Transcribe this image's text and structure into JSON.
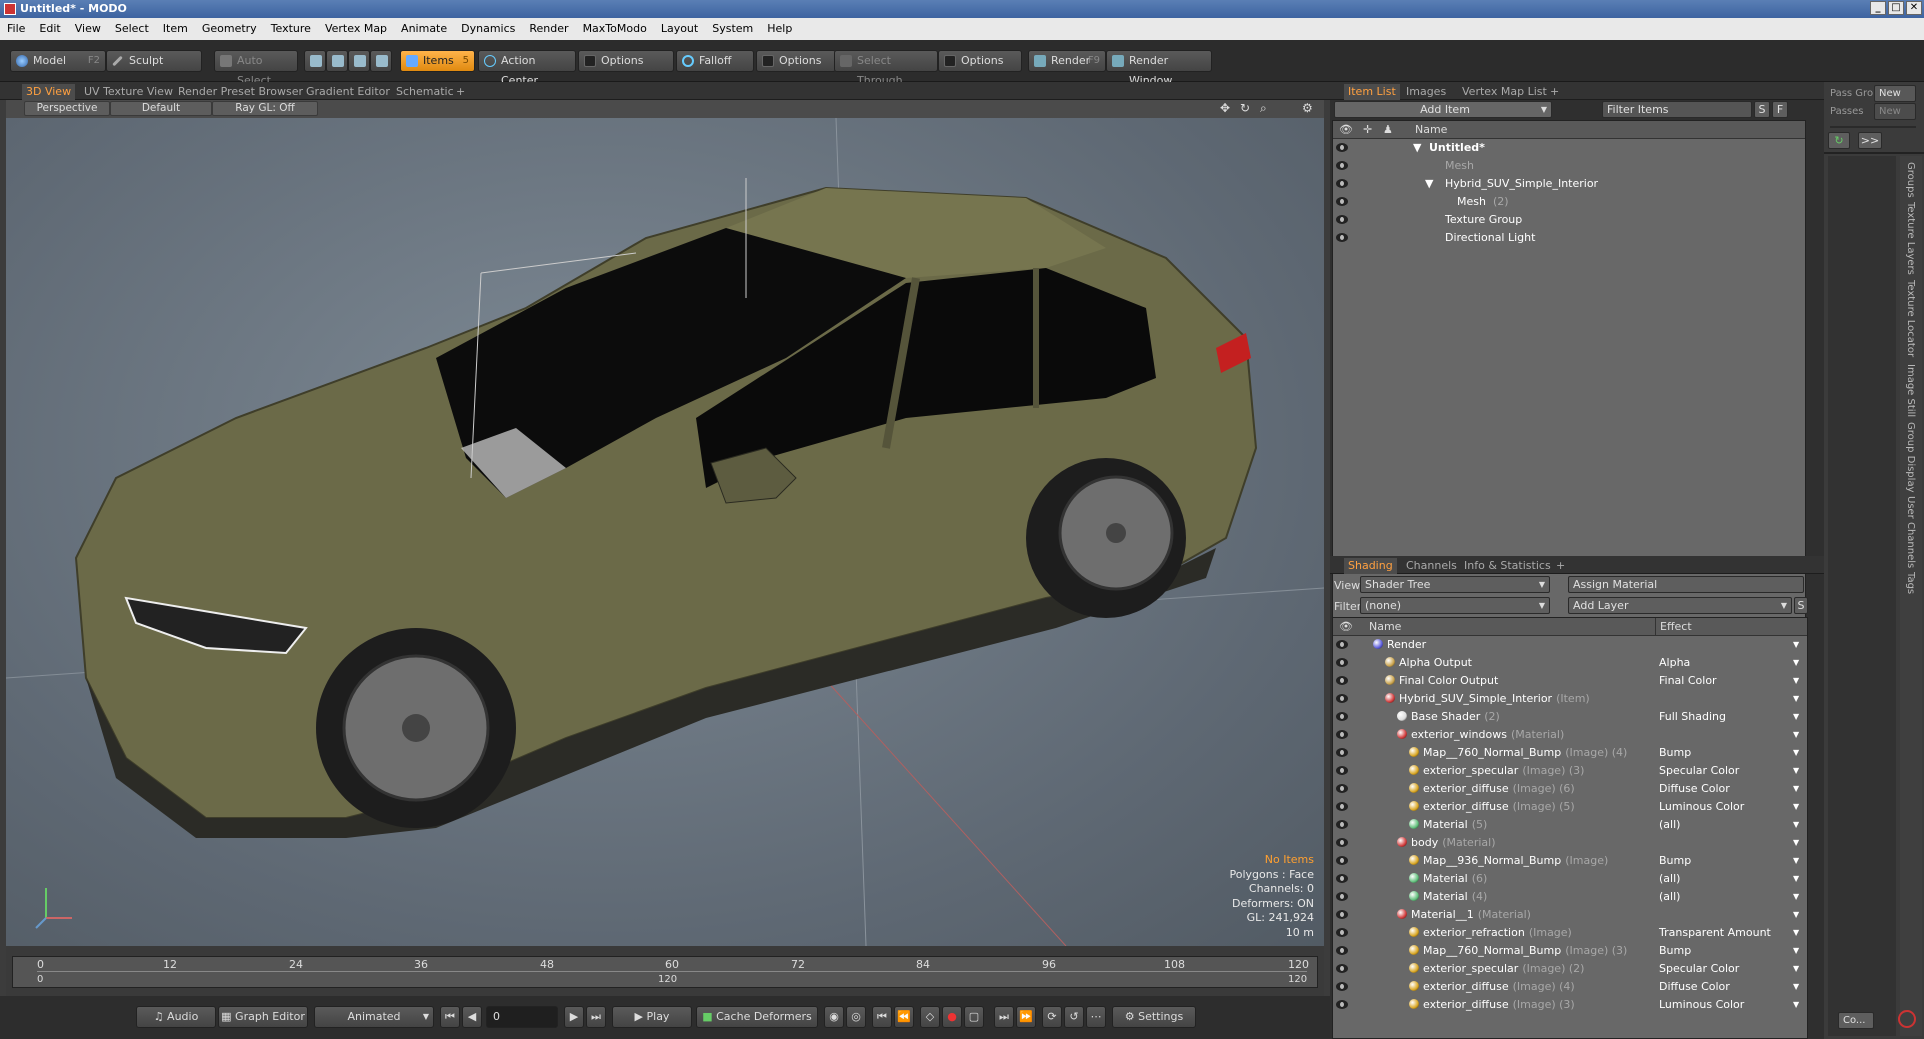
{
  "window": {
    "title": "Untitled* - MODO"
  },
  "menu": [
    "File",
    "Edit",
    "View",
    "Select",
    "Item",
    "Geometry",
    "Texture",
    "Vertex Map",
    "Animate",
    "Dynamics",
    "Render",
    "MaxToModo",
    "Layout",
    "System",
    "Help"
  ],
  "toolbar": {
    "model": "Model",
    "model_key": "F2",
    "sculpt": "Sculpt",
    "auto_select": "Auto Select",
    "items": "Items",
    "items_key": "5",
    "action_center": "Action Center",
    "options1": "Options",
    "falloff": "Falloff",
    "options2": "Options",
    "select_through": "Select Through",
    "options3": "Options",
    "render": "Render",
    "render_key": "F9",
    "render_window": "Render Window"
  },
  "viewport": {
    "tabs": [
      "3D View",
      "UV Texture View",
      "Render Preset Browser",
      "Gradient Editor",
      "Schematic",
      "+"
    ],
    "perspective": "Perspective",
    "default": "Default",
    "raygl": "Ray GL: Off",
    "stats": {
      "items": "No Items",
      "polygons": "Polygons : Face",
      "channels": "Channels: 0",
      "deformers": "Deformers: ON",
      "gl": "GL: 241,924",
      "scale": "10 m"
    }
  },
  "timeline": {
    "ticks": [
      "0",
      "12",
      "24",
      "36",
      "48",
      "60",
      "72",
      "84",
      "96",
      "108",
      "120"
    ],
    "start": "0",
    "mid": "120",
    "end": "120"
  },
  "transport": {
    "audio": "Audio",
    "graph_editor": "Graph Editor",
    "animated": "Animated",
    "frame": "0",
    "play": "Play",
    "cache_deformers": "Cache Deformers",
    "settings": "Settings"
  },
  "item_list": {
    "tabs": [
      "Item List",
      "Images",
      "Vertex Map List",
      "+"
    ],
    "add_item": "Add Item",
    "filter": "Filter Items",
    "s": "S",
    "f": "F",
    "col_name": "Name",
    "rows": [
      {
        "name": "Untitled*",
        "tag": ""
      },
      {
        "name": "Mesh",
        "tag": ""
      },
      {
        "name": "Hybrid_SUV_Simple_Interior",
        "tag": ""
      },
      {
        "name": "Mesh",
        "tag": "(2)"
      },
      {
        "name": "Texture Group",
        "tag": ""
      },
      {
        "name": "Directional Light",
        "tag": ""
      }
    ]
  },
  "shading": {
    "tabs": [
      "Shading",
      "Channels",
      "Info & Statistics",
      "+"
    ],
    "view_label": "View",
    "view": "Shader Tree",
    "assign": "Assign Material",
    "f": "F",
    "filter_label": "Filter",
    "filter": "(none)",
    "add_layer": "Add Layer",
    "s": "S",
    "col_name": "Name",
    "col_effect": "Effect",
    "rows": [
      {
        "name": "Render",
        "tag": "",
        "effect": "",
        "indent": 0,
        "color": "#5b5bdc"
      },
      {
        "name": "Alpha Output",
        "tag": "",
        "effect": "Alpha",
        "indent": 1,
        "color": "#c9a24a"
      },
      {
        "name": "Final Color Output",
        "tag": "",
        "effect": "Final Color",
        "indent": 1,
        "color": "#c9a24a"
      },
      {
        "name": "Hybrid_SUV_Simple_Interior",
        "tag": "(Item)",
        "effect": "",
        "indent": 1,
        "color": "#d23a3a"
      },
      {
        "name": "Base Shader",
        "tag": "(2)",
        "effect": "Full Shading",
        "indent": 2,
        "color": "#dddddd"
      },
      {
        "name": "exterior_windows",
        "tag": "(Material)",
        "effect": "",
        "indent": 2,
        "color": "#d23a3a"
      },
      {
        "name": "Map__760_Normal_Bump",
        "tag": "(Image) (4)",
        "effect": "Bump",
        "indent": 3,
        "color": "#d9a520"
      },
      {
        "name": "exterior_specular",
        "tag": "(Image) (3)",
        "effect": "Specular Color",
        "indent": 3,
        "color": "#d9a520"
      },
      {
        "name": "exterior_diffuse",
        "tag": "(Image) (6)",
        "effect": "Diffuse Color",
        "indent": 3,
        "color": "#d9a520"
      },
      {
        "name": "exterior_diffuse",
        "tag": "(Image) (5)",
        "effect": "Luminous Color",
        "indent": 3,
        "color": "#d9a520"
      },
      {
        "name": "Material",
        "tag": "(5)",
        "effect": "(all)",
        "indent": 3,
        "color": "#5fbf7a"
      },
      {
        "name": "body",
        "tag": "(Material)",
        "effect": "",
        "indent": 2,
        "color": "#d23a3a"
      },
      {
        "name": "Map__936_Normal_Bump",
        "tag": "(Image)",
        "effect": "Bump",
        "indent": 3,
        "color": "#d9a520"
      },
      {
        "name": "Material",
        "tag": "(6)",
        "effect": "(all)",
        "indent": 3,
        "color": "#5fbf7a"
      },
      {
        "name": "Material",
        "tag": "(4)",
        "effect": "(all)",
        "indent": 3,
        "color": "#5fbf7a"
      },
      {
        "name": "Material__1",
        "tag": "(Material)",
        "effect": "",
        "indent": 2,
        "color": "#d23a3a"
      },
      {
        "name": "exterior_refraction",
        "tag": "(Image)",
        "effect": "Transparent Amount",
        "indent": 3,
        "color": "#d9a520"
      },
      {
        "name": "Map__760_Normal_Bump",
        "tag": "(Image) (3)",
        "effect": "Bump",
        "indent": 3,
        "color": "#d9a520"
      },
      {
        "name": "exterior_specular",
        "tag": "(Image) (2)",
        "effect": "Specular Color",
        "indent": 3,
        "color": "#d9a520"
      },
      {
        "name": "exterior_diffuse",
        "tag": "(Image) (4)",
        "effect": "Diffuse Color",
        "indent": 3,
        "color": "#d9a520"
      },
      {
        "name": "exterior_diffuse",
        "tag": "(Image) (3)",
        "effect": "Luminous Color",
        "indent": 3,
        "color": "#d9a520"
      }
    ]
  },
  "side": {
    "pass_label": "Pass Gro",
    "pass_new": "New",
    "passes_label": "Passes",
    "passes_new": "New",
    "arrows": ">>",
    "vertical": [
      "Groups",
      "Texture Layers",
      "Texture Locator",
      "Image Still",
      "Group Display",
      "User Channels",
      "Tags"
    ],
    "co": "Co..."
  }
}
